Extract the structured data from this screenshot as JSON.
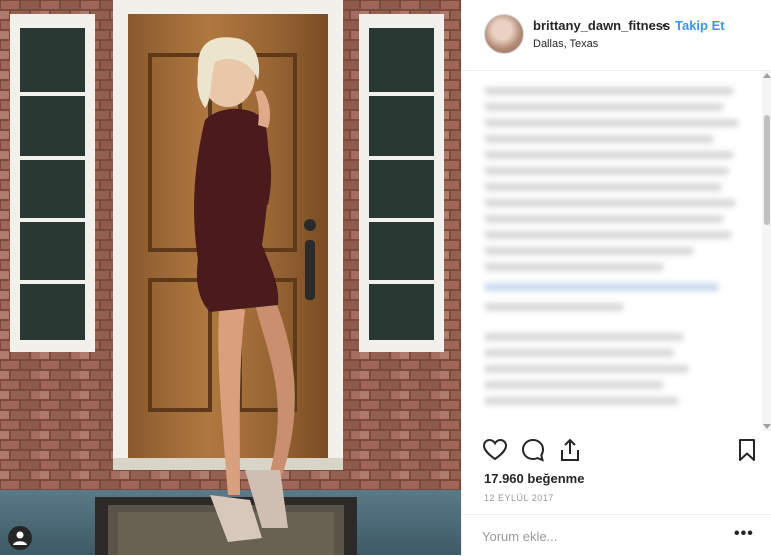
{
  "post": {
    "username": "brittany_dawn_fitness",
    "separator": "•",
    "follow_label": "Takip Et",
    "location": "Dallas, Texas",
    "likes": "17.960 beğenme",
    "date": "12 EYLÜL 2017",
    "comment_placeholder": "Yorum ekle...",
    "more_label": "•••"
  },
  "colors": {
    "accent": "#3897f0",
    "text": "#262626",
    "muted": "#999999",
    "border": "#efefef"
  },
  "icons": {
    "like": "heart-icon",
    "comment": "comment-icon",
    "share": "share-icon",
    "save": "bookmark-icon",
    "user": "user-icon"
  }
}
